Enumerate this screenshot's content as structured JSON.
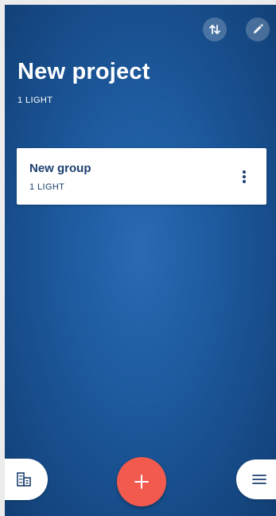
{
  "project": {
    "title": "New project",
    "light_count_label": "1 LIGHT"
  },
  "toolbar": {
    "sort_icon": "sort-arrows-icon",
    "edit_icon": "pencil-icon"
  },
  "groups": [
    {
      "name": "New group",
      "light_count_label": "1 LIGHT",
      "menu_icon": "more-vertical-icon"
    }
  ],
  "bottom_bar": {
    "left_icon": "building-icon",
    "center_icon": "plus-icon",
    "right_icon": "hamburger-menu-icon"
  },
  "colors": {
    "background": "#1d5a9e",
    "card_text": "#1b3f6e",
    "fab": "#f25a4e",
    "white": "#ffffff"
  }
}
